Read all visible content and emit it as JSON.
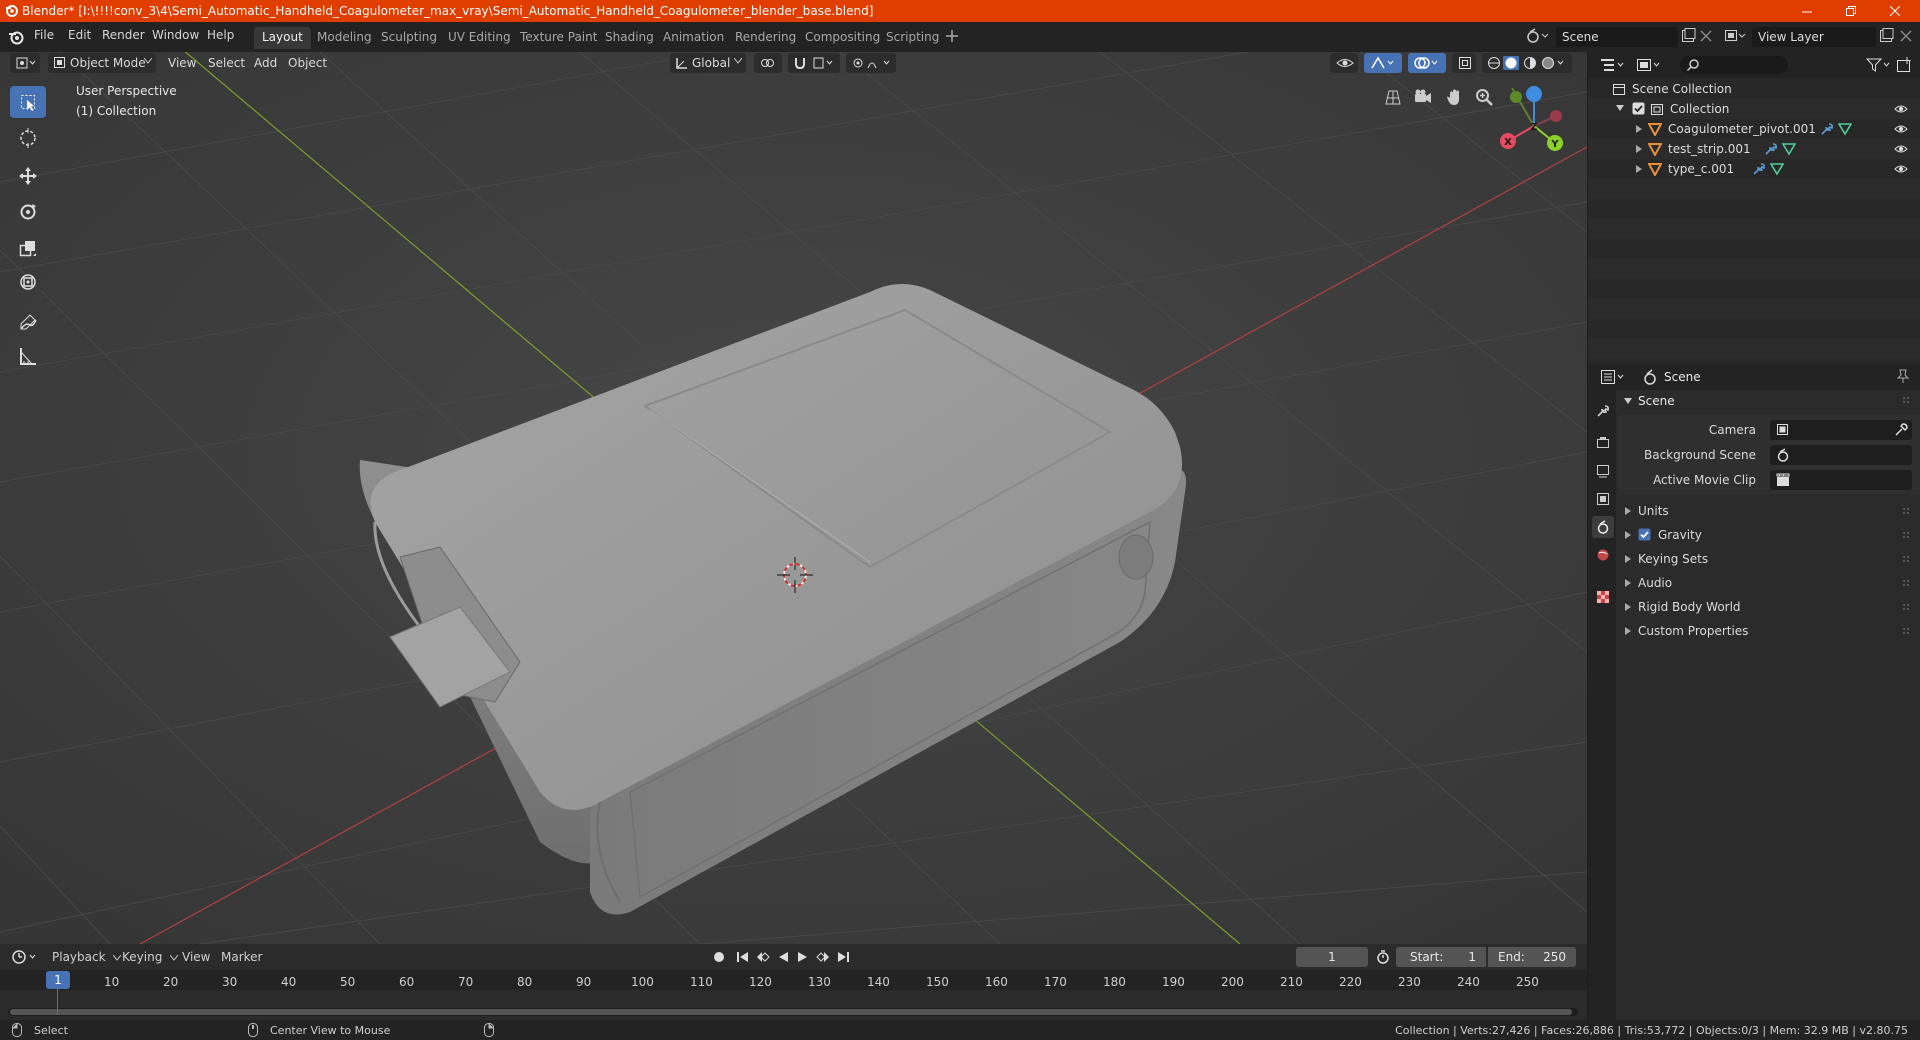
{
  "window": {
    "title": "Blender* [I:\\!!!!conv_3\\4\\Semi_Automatic_Handheld_Coagulometer_max_vray\\Semi_Automatic_Handheld_Coagulometer_blender_base.blend]"
  },
  "menu": [
    "File",
    "Edit",
    "Render",
    "Window",
    "Help"
  ],
  "workspaces": [
    "Layout",
    "Modeling",
    "Sculpting",
    "UV Editing",
    "Texture Paint",
    "Shading",
    "Animation",
    "Rendering",
    "Compositing",
    "Scripting"
  ],
  "active_workspace": "Layout",
  "scene_field": "Scene",
  "view_layer_field": "View Layer",
  "viewport": {
    "mode": "Object Mode",
    "menus": [
      "View",
      "Select",
      "Add",
      "Object"
    ],
    "transform_orientation": "Global",
    "overlay_text": {
      "perspective": "User Perspective",
      "collection": "(1) Collection"
    },
    "gizmo_axes": {
      "x": "X",
      "y": "Y",
      "z": "Z"
    }
  },
  "outliner": {
    "root": "Scene Collection",
    "collection": "Collection",
    "objects": [
      "Coagulometer_pivot.001",
      "test_strip.001",
      "type_c.001"
    ]
  },
  "properties": {
    "header_title": "Scene",
    "panel_title": "Scene",
    "fields": [
      {
        "label": "Camera"
      },
      {
        "label": "Background Scene"
      },
      {
        "label": "Active Movie Clip"
      }
    ],
    "sections": [
      "Units",
      "Gravity",
      "Keying Sets",
      "Audio",
      "Rigid Body World",
      "Custom Properties"
    ],
    "gravity_enabled": true
  },
  "timeline": {
    "menus": [
      "Playback",
      "Keying",
      "View",
      "Marker"
    ],
    "current_frame": "1",
    "start_label": "Start:",
    "start": "1",
    "end_label": "End:",
    "end": "250",
    "ticks": [
      "1",
      "10",
      "20",
      "30",
      "40",
      "50",
      "60",
      "70",
      "80",
      "90",
      "100",
      "110",
      "120",
      "130",
      "140",
      "150",
      "160",
      "170",
      "180",
      "190",
      "200",
      "210",
      "220",
      "230",
      "240",
      "250"
    ]
  },
  "status": {
    "left_action": "Select",
    "middle_action": "Center View to Mouse",
    "stats": "Collection | Verts:27,426 | Faces:26,886 | Tris:53,772 | Objects:0/3 | Mem: 32.9 MB | v2.80.75"
  },
  "colors": {
    "titlebar": "#e03e00",
    "accent": "#4772b3",
    "mesh_icon": "#e8903a",
    "x_axis": "#e84a5f",
    "y_axis": "#8bd12a",
    "z_axis": "#3d8ce0"
  }
}
